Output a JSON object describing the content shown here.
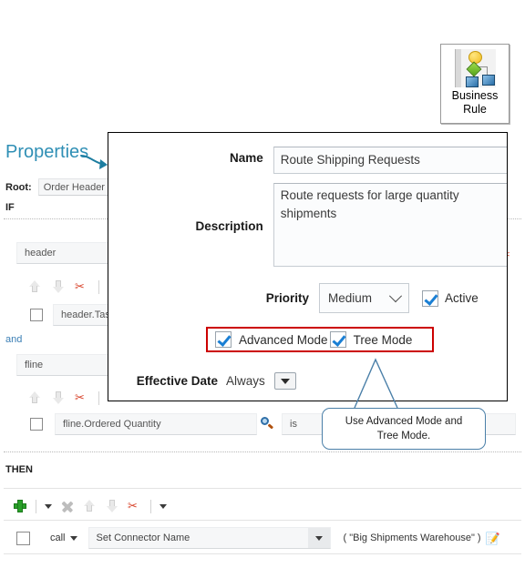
{
  "palette": {
    "tile_label": "Business\nRule",
    "tile_label_line1": "Business",
    "tile_label_line2": "Rule",
    "icon": "business-rule-flow-icon"
  },
  "editor": {
    "title": "Properties",
    "root_label": "Root:",
    "root_value": "Order Header",
    "if_label": "IF",
    "then_label": "THEN",
    "bucket_header": "header",
    "bucket_fline": "fline",
    "condition_header_text": "header.Tas",
    "connector_word": "and",
    "condition_fline_text": "fline.Ordered Quantity",
    "operator_text": "is",
    "search_icon": "search-icon",
    "action_call_label": "call",
    "action_connector_value": "Set Connector Name",
    "action_params": "( \"Big Shipments Warehouse\" )",
    "pencil_icon": "edit-pencil-icon",
    "toolbar": {
      "add": "add-icon",
      "add_menu": "add-dropdown-caret",
      "delete": "delete-icon",
      "move_up": "move-up-icon",
      "move_down": "move-down-icon",
      "cut": "cut-scissors-icon",
      "more_menu": "more-dropdown-caret"
    }
  },
  "dialog": {
    "name_label": "Name",
    "name_value": "Route Shipping Requests",
    "description_label": "Description",
    "description_value": "Route requests for large quantity shipments",
    "priority_label": "Priority",
    "priority_value": "Medium",
    "priority_options": [
      "Medium"
    ],
    "active_label": "Active",
    "active_checked": true,
    "advanced_mode_label": "Advanced Mode",
    "advanced_mode_checked": true,
    "tree_mode_label": "Tree Mode",
    "tree_mode_checked": true,
    "effective_date_label": "Effective Date",
    "effective_date_value": "Always",
    "effective_date_caret": "dropdown-caret-icon"
  },
  "annotation": {
    "callout_text": "Use Advanced  Mode and\nTree  Mode.",
    "highlight_color": "#cc0000",
    "callout_border_color": "#4a7fa8",
    "pointer_color": "#4a7fa8",
    "title_color": "#2f8fb5"
  }
}
